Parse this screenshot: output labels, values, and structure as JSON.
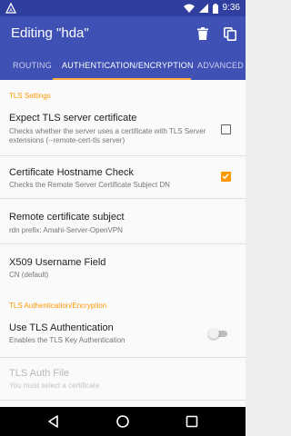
{
  "status_bar": {
    "time": "9:36",
    "icons": [
      "notification-icon",
      "wifi-icon",
      "cellular-icon",
      "battery-icon"
    ]
  },
  "app_bar": {
    "title": "Editing \"hda\"",
    "actions": [
      "delete-icon",
      "copy-icon"
    ]
  },
  "tabs": [
    {
      "label": "ROUTING",
      "active": false
    },
    {
      "label": "AUTHENTICATION/ENCRYPTION",
      "active": true
    },
    {
      "label": "ADVANCED",
      "active": false
    }
  ],
  "sections": {
    "tls_settings": "TLS Settings",
    "tls_auth": "TLS Authentication/Encryption"
  },
  "prefs": {
    "expect_tls": {
      "title": "Expect TLS server certificate",
      "summary": "Checks whether the server uses a certificate with TLS Server extensions (--remote-cert-tls server)",
      "checked": false
    },
    "hostname_check": {
      "title": "Certificate Hostname Check",
      "summary": "Checks the Remote Server Certificate Subject DN",
      "checked": true
    },
    "remote_subject": {
      "title": "Remote certificate subject",
      "summary": "rdn prefix: Amahi-Server-OpenVPN"
    },
    "x509_field": {
      "title": "X509 Username Field",
      "summary": "CN (default)"
    },
    "use_tls_auth": {
      "title": "Use TLS Authentication",
      "summary": "Enables the TLS Key Authentication",
      "enabled": false
    },
    "tls_auth_file": {
      "title": "TLS Auth File",
      "summary": "You must select a certificate"
    }
  },
  "colors": {
    "primary": "#3f51b5",
    "primary_dark": "#303f9f",
    "accent": "#ff9800"
  }
}
